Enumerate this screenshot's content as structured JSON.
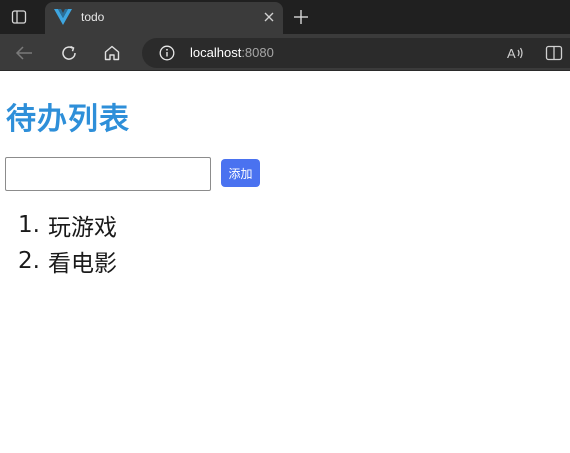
{
  "browser": {
    "tab": {
      "title": "todo",
      "favicon": "vue-logo-icon",
      "favicon_color": "#3ea6e0"
    },
    "address": {
      "host": "localhost",
      "port": ":8080"
    },
    "icons": {
      "tab_actions": "tab-actions-icon",
      "close": "close-icon",
      "new_tab": "plus-icon",
      "back": "back-arrow-icon",
      "reload": "reload-icon",
      "home": "home-icon",
      "site_info": "info-icon",
      "read_aloud": "read-aloud-icon",
      "split_screen": "split-screen-icon"
    }
  },
  "page": {
    "title": "待办列表",
    "title_color": "#2e8fd9",
    "input": {
      "value": "",
      "placeholder": ""
    },
    "add_button_label": "添加",
    "add_button_color": "#4a72f0",
    "todos": [
      {
        "number": "1.",
        "text": "玩游戏"
      },
      {
        "number": "2.",
        "text": "看电影"
      }
    ]
  }
}
